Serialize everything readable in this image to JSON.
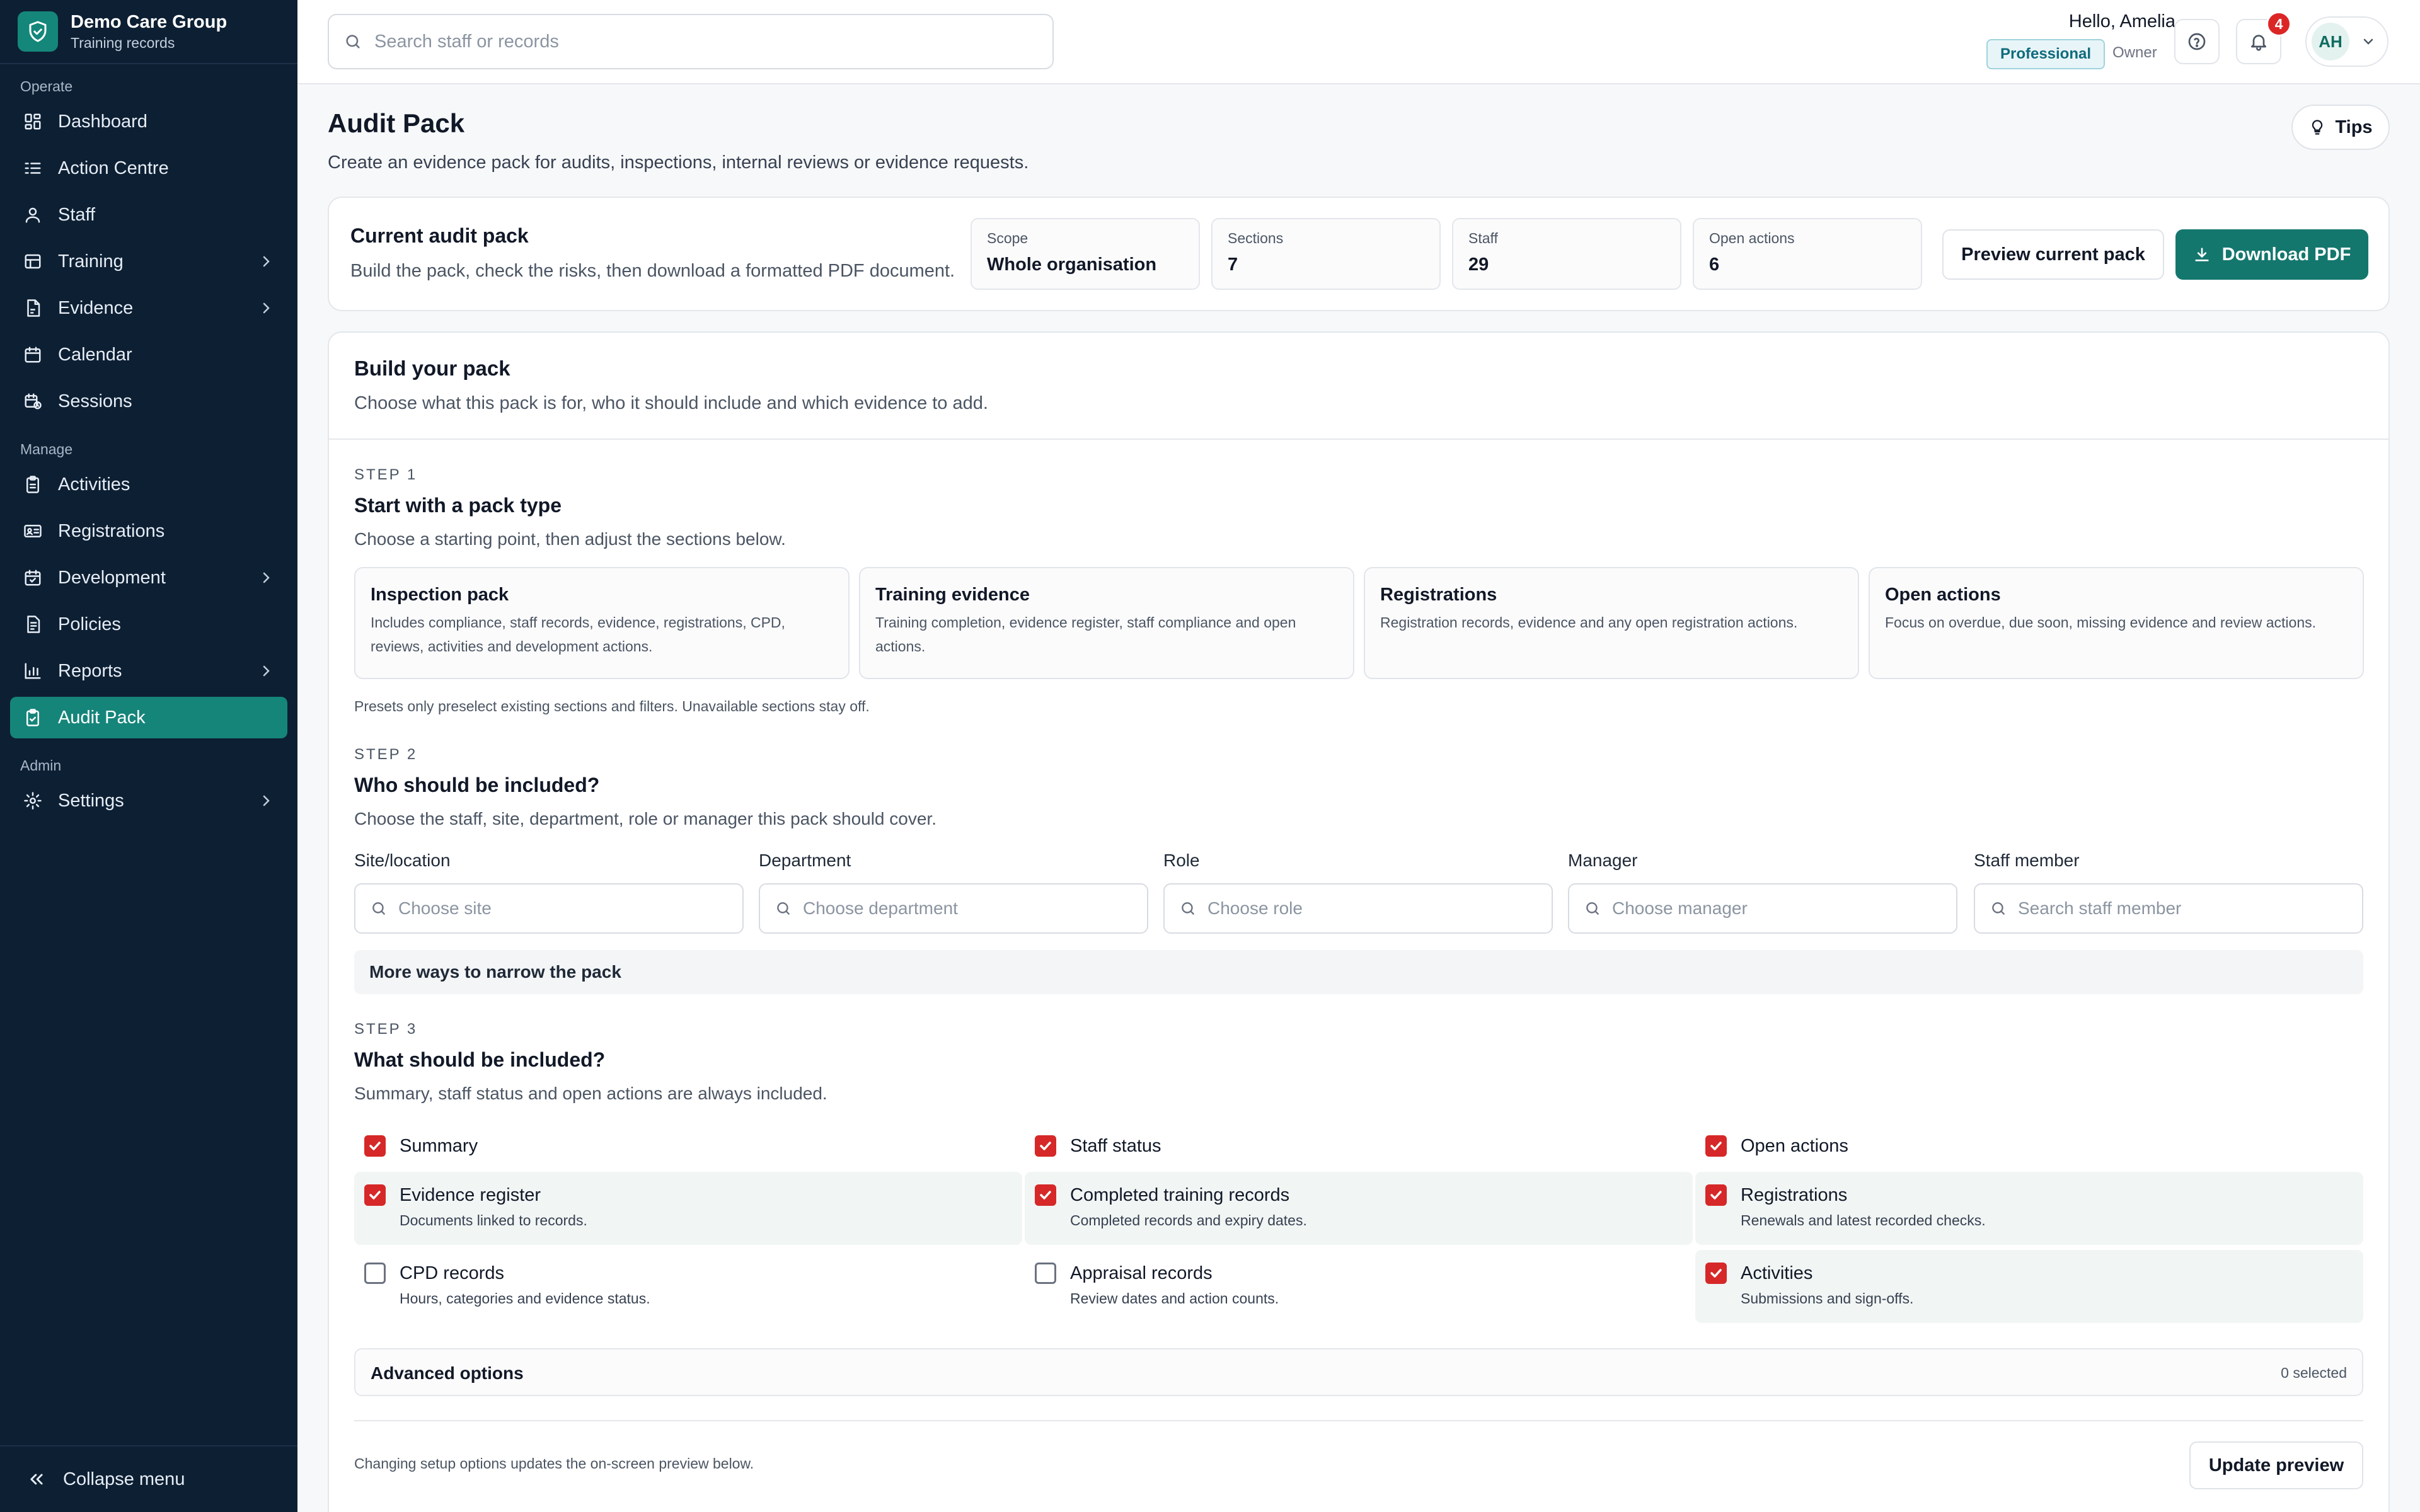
{
  "brand": {
    "name": "Demo Care Group",
    "subtitle": "Training records"
  },
  "sidebar": {
    "sections": {
      "operate": "Operate",
      "manage": "Manage",
      "admin": "Admin"
    },
    "items": [
      {
        "label": "Dashboard",
        "icon": "dashboard-icon"
      },
      {
        "label": "Action Centre",
        "icon": "action-centre-icon"
      },
      {
        "label": "Staff",
        "icon": "staff-icon"
      },
      {
        "label": "Training",
        "icon": "training-icon",
        "has_submenu": true
      },
      {
        "label": "Evidence",
        "icon": "evidence-icon",
        "has_submenu": true
      },
      {
        "label": "Calendar",
        "icon": "calendar-icon"
      },
      {
        "label": "Sessions",
        "icon": "sessions-icon"
      },
      {
        "label": "Activities",
        "icon": "activities-icon"
      },
      {
        "label": "Registrations",
        "icon": "registrations-icon"
      },
      {
        "label": "Development",
        "icon": "development-icon",
        "has_submenu": true
      },
      {
        "label": "Policies",
        "icon": "policies-icon"
      },
      {
        "label": "Reports",
        "icon": "reports-icon",
        "has_submenu": true
      },
      {
        "label": "Audit Pack",
        "icon": "audit-pack-icon",
        "active": true
      },
      {
        "label": "Settings",
        "icon": "settings-icon",
        "has_submenu": true
      }
    ],
    "collapse_label": "Collapse menu"
  },
  "topbar": {
    "search_placeholder": "Search staff or records",
    "greeting": "Hello, Amelia",
    "plan": "Professional",
    "role": "Owner",
    "notification_count": "4",
    "avatar_initials": "AH"
  },
  "page": {
    "title": "Audit Pack",
    "description": "Create an evidence pack for audits, inspections, internal reviews or evidence requests.",
    "tips_label": "Tips"
  },
  "current_pack": {
    "title": "Current audit pack",
    "description": "Build the pack, check the risks, then download a formatted PDF document.",
    "stats": [
      {
        "label": "Scope",
        "value": "Whole organisation"
      },
      {
        "label": "Sections",
        "value": "7"
      },
      {
        "label": "Staff",
        "value": "29"
      },
      {
        "label": "Open actions",
        "value": "6"
      }
    ],
    "preview_label": "Preview current pack",
    "download_label": "Download PDF"
  },
  "build": {
    "title": "Build your pack",
    "description": "Choose what this pack is for, who it should include and which evidence to add.",
    "step1": {
      "label": "STEP 1",
      "title": "Start with a pack type",
      "description": "Choose a starting point, then adjust the sections below.",
      "presets": [
        {
          "title": "Inspection pack",
          "description": "Includes compliance, staff records, evidence, registrations, CPD, reviews, activities and development actions."
        },
        {
          "title": "Training evidence",
          "description": "Training completion, evidence register, staff compliance and open actions."
        },
        {
          "title": "Registrations",
          "description": "Registration records, evidence and any open registration actions."
        },
        {
          "title": "Open actions",
          "description": "Focus on overdue, due soon, missing evidence and review actions."
        }
      ],
      "note": "Presets only preselect existing sections and filters. Unavailable sections stay off."
    },
    "step2": {
      "label": "STEP 2",
      "title": "Who should be included?",
      "description": "Choose the staff, site, department, role or manager this pack should cover.",
      "filters": [
        {
          "label": "Site/location",
          "placeholder": "Choose site"
        },
        {
          "label": "Department",
          "placeholder": "Choose department"
        },
        {
          "label": "Role",
          "placeholder": "Choose role"
        },
        {
          "label": "Manager",
          "placeholder": "Choose manager"
        },
        {
          "label": "Staff member",
          "placeholder": "Search staff member"
        }
      ],
      "narrow_label": "More ways to narrow the pack"
    },
    "step3": {
      "label": "STEP 3",
      "title": "What should be included?",
      "description": "Summary, staff status and open actions are always included.",
      "options": [
        {
          "title": "Summary",
          "description": "",
          "checked": true
        },
        {
          "title": "Staff status",
          "description": "",
          "checked": true
        },
        {
          "title": "Open actions",
          "description": "",
          "checked": true
        },
        {
          "title": "Evidence register",
          "description": "Documents linked to records.",
          "checked": true
        },
        {
          "title": "Completed training records",
          "description": "Completed records and expiry dates.",
          "checked": true
        },
        {
          "title": "Registrations",
          "description": "Renewals and latest recorded checks.",
          "checked": true
        },
        {
          "title": "CPD records",
          "description": "Hours, categories and evidence status.",
          "checked": false
        },
        {
          "title": "Appraisal records",
          "description": "Review dates and action counts.",
          "checked": false
        },
        {
          "title": "Activities",
          "description": "Submissions and sign-offs.",
          "checked": true
        }
      ]
    },
    "advanced": {
      "label": "Advanced options",
      "count": "0 selected"
    },
    "footer_note": "Changing setup options updates the on-screen preview below.",
    "update_label": "Update preview"
  },
  "colors": {
    "sidebar_bg": "#0d1f33",
    "accent": "#14776e",
    "active_nav": "#15857a",
    "checkbox": "#d62828",
    "badge": "#dc2626"
  }
}
